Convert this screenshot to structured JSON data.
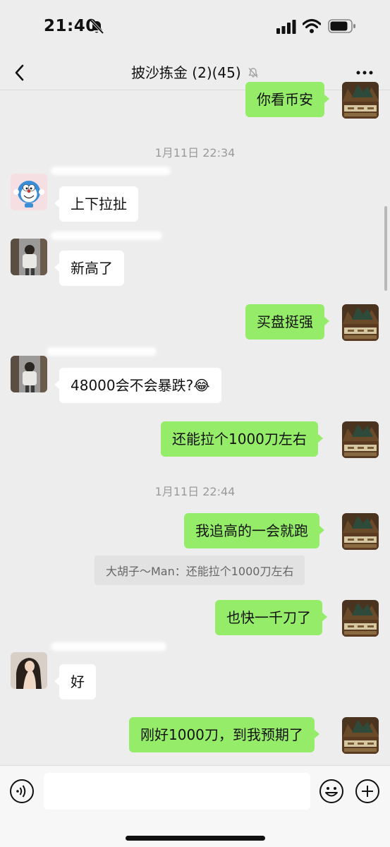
{
  "status": {
    "time": "21:40"
  },
  "header": {
    "title": "披沙拣金 (2)(45)"
  },
  "messages": {
    "m1": "你看币安",
    "sep1": "1月11日 22:34",
    "m2": "上下拉扯",
    "m3": "新高了",
    "m4": "买盘挺强",
    "m5": "48000会不会暴跌?😂",
    "m6": "还能拉个1000刀左右",
    "sep2": "1月11日 22:44",
    "m7": "我追高的一会就跑",
    "m7_quote": "大胡子～Man：还能拉个1000刀左右",
    "m8": "也快一千刀了",
    "m9": "好",
    "m10": "刚好1000刀，到我预期了"
  },
  "colors": {
    "outgoing_bubble": "#95ec69",
    "incoming_bubble": "#ffffff",
    "background": "#ededed"
  },
  "icons": [
    "back-icon",
    "mute-icon",
    "more-icon",
    "voice-icon",
    "emoji-icon",
    "plus-icon"
  ]
}
